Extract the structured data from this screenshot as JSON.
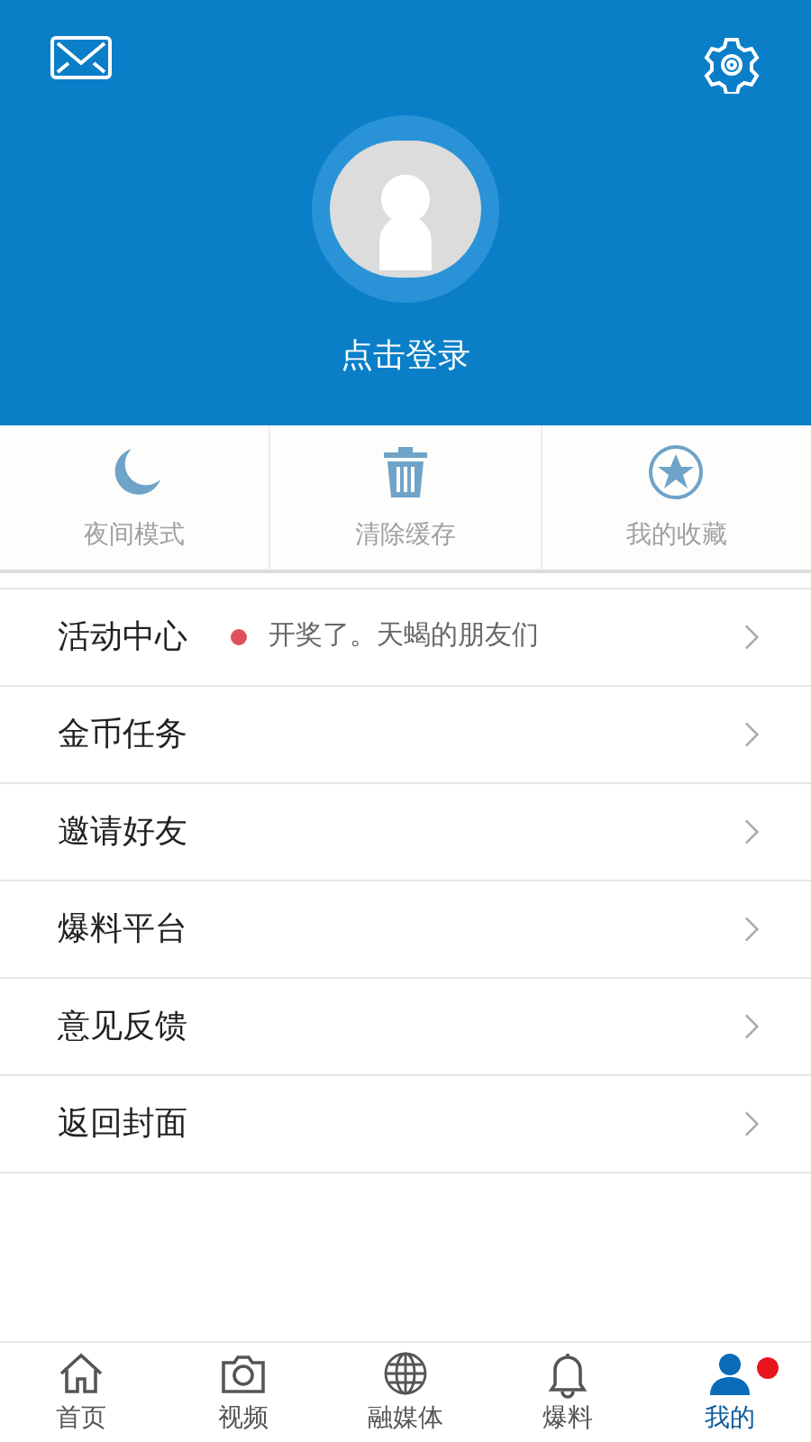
{
  "header": {
    "login_text": "点击登录"
  },
  "quick_actions": [
    {
      "label": "夜间模式"
    },
    {
      "label": "清除缓存"
    },
    {
      "label": "我的收藏"
    }
  ],
  "menu": [
    {
      "label": "活动中心",
      "notice": "开奖了。天蝎的朋友们"
    },
    {
      "label": "金币任务"
    },
    {
      "label": "邀请好友"
    },
    {
      "label": "爆料平台"
    },
    {
      "label": "意见反馈"
    },
    {
      "label": "返回封面"
    }
  ],
  "tabs": [
    {
      "label": "首页",
      "selected": false,
      "badge": false
    },
    {
      "label": "视频",
      "selected": false,
      "badge": false
    },
    {
      "label": "融媒体",
      "selected": false,
      "badge": false
    },
    {
      "label": "爆料",
      "selected": false,
      "badge": false
    },
    {
      "label": "我的",
      "selected": true,
      "badge": true
    }
  ]
}
